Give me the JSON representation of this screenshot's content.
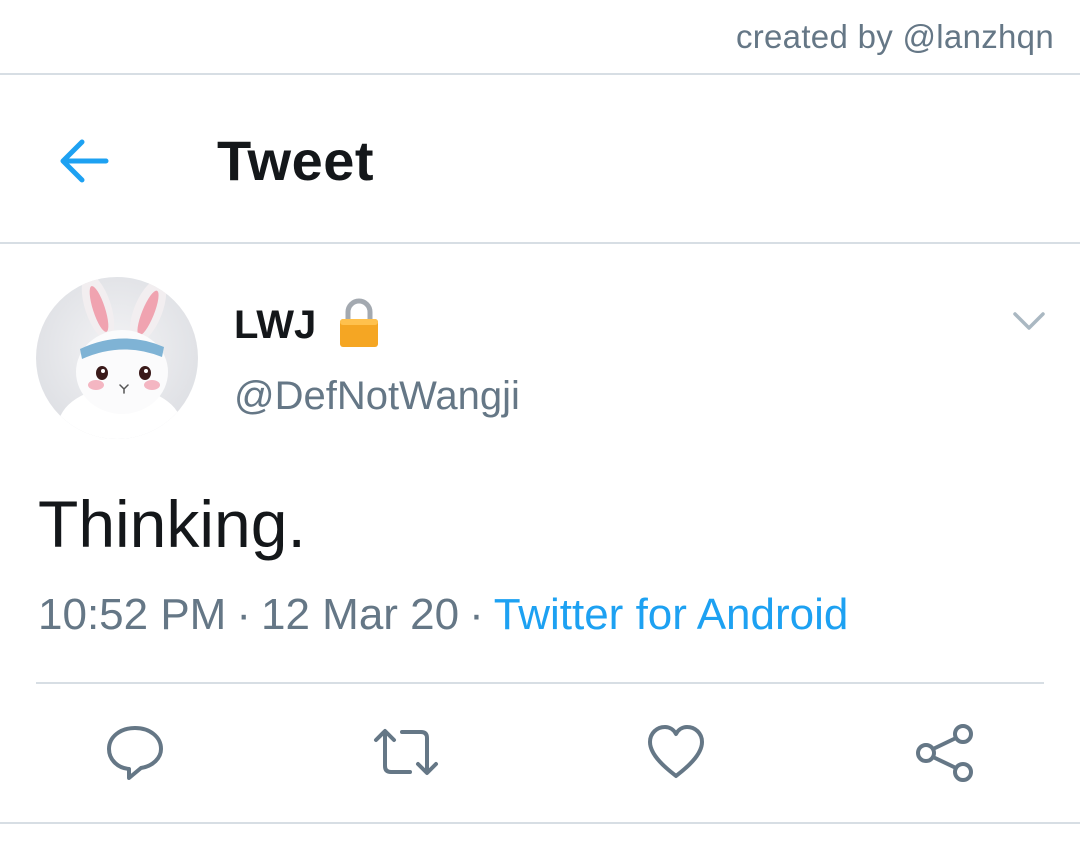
{
  "credit": "created by @lanzhqn",
  "header": {
    "title": "Tweet",
    "back_icon": "arrow-left-icon"
  },
  "tweet": {
    "display_name": "LWJ",
    "handle": "@DefNotWangji",
    "protected_icon": "lock-icon",
    "text": "Thinking.",
    "time": "10:52 PM",
    "date": "12 Mar 20",
    "separator": "·",
    "source": "Twitter for Android"
  },
  "actions": [
    {
      "name": "reply",
      "icon": "speech-bubble-icon"
    },
    {
      "name": "retweet",
      "icon": "retweet-icon"
    },
    {
      "name": "like",
      "icon": "heart-icon"
    },
    {
      "name": "share",
      "icon": "share-icon"
    }
  ],
  "colors": {
    "accent": "#1da1f2",
    "text": "#14171a",
    "muted": "#657786",
    "divider": "#d7dee4",
    "lock": "#f5a623"
  }
}
